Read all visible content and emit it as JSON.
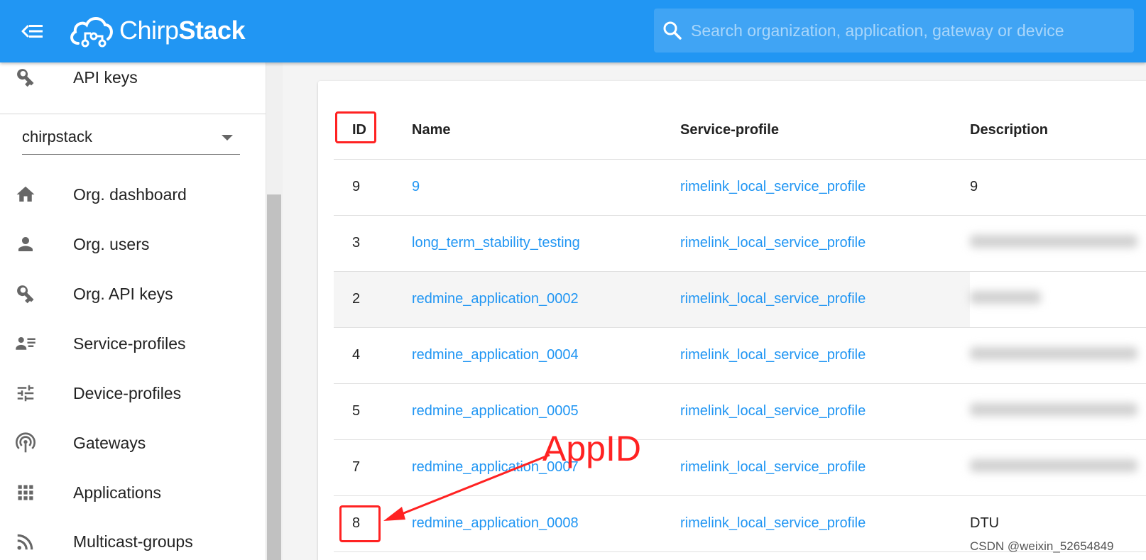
{
  "header": {
    "logo_text_a": "Chirp",
    "logo_text_b": "Stack",
    "search_placeholder": "Search organization, application, gateway or device"
  },
  "sidebar": {
    "top_item": "API keys",
    "org_selected": "chirpstack",
    "items": [
      {
        "label": "Org. dashboard",
        "icon": "home-icon"
      },
      {
        "label": "Org. users",
        "icon": "person-icon"
      },
      {
        "label": "Org. API keys",
        "icon": "key-icon"
      },
      {
        "label": "Service-profiles",
        "icon": "account-details-icon"
      },
      {
        "label": "Device-profiles",
        "icon": "tune-icon"
      },
      {
        "label": "Gateways",
        "icon": "antenna-icon"
      },
      {
        "label": "Applications",
        "icon": "apps-grid-icon"
      },
      {
        "label": "Multicast-groups",
        "icon": "rss-icon"
      }
    ]
  },
  "table": {
    "columns": [
      "ID",
      "Name",
      "Service-profile",
      "Description"
    ],
    "rows": [
      {
        "id": "9",
        "name": "9",
        "service_profile": "rimelink_local_service_profile",
        "description": "9"
      },
      {
        "id": "3",
        "name": "long_term_stability_testing",
        "service_profile": "rimelink_local_service_profile",
        "description": ""
      },
      {
        "id": "2",
        "name": "redmine_application_0002",
        "service_profile": "rimelink_local_service_profile",
        "description": ""
      },
      {
        "id": "4",
        "name": "redmine_application_0004",
        "service_profile": "rimelink_local_service_profile",
        "description": ""
      },
      {
        "id": "5",
        "name": "redmine_application_0005",
        "service_profile": "rimelink_local_service_profile",
        "description": ""
      },
      {
        "id": "7",
        "name": "redmine_application_0007",
        "service_profile": "rimelink_local_service_profile",
        "description": ""
      },
      {
        "id": "8",
        "name": "redmine_application_0008",
        "service_profile": "rimelink_local_service_profile",
        "description": "DTU"
      }
    ]
  },
  "annotation": {
    "label": "AppID",
    "color": "#ff2222"
  },
  "watermark": "CSDN @weixin_52654849",
  "colors": {
    "primary": "#2196f3",
    "link": "#2196f3"
  }
}
